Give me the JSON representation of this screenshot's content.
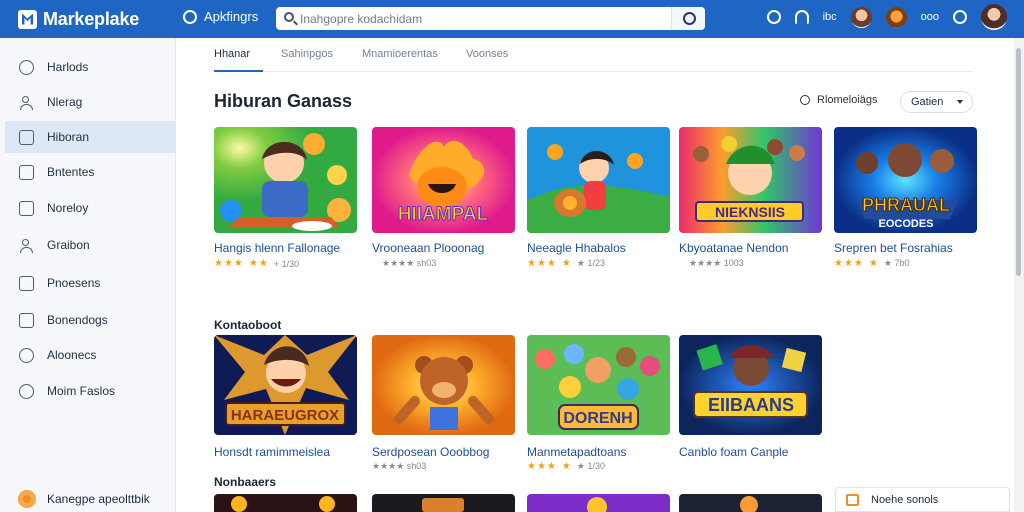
{
  "header": {
    "app_name": "Markeplake",
    "nav_label": "Apkfingrs",
    "search_value": "Inahgopre kodachidam",
    "right_text": "ibc",
    "right_text_2": "ooo"
  },
  "sidebar": {
    "items": [
      {
        "label": "Harlods"
      },
      {
        "label": "Nlerag"
      },
      {
        "label": "Hiboran"
      },
      {
        "label": "Bntentes"
      },
      {
        "label": "Noreloy"
      },
      {
        "label": "Graibon"
      },
      {
        "label": "Pnoesens"
      },
      {
        "label": "Bonendogs"
      },
      {
        "label": "Aloonecs"
      },
      {
        "label": "Moim Faslos"
      }
    ],
    "footer": "Kanegpe apeolttbik"
  },
  "tabs": [
    {
      "label": "Hhanar"
    },
    {
      "label": "Sahinpgos"
    },
    {
      "label": "Mnamioerentas"
    },
    {
      "label": "Voonses"
    }
  ],
  "page": {
    "title": "Hiburan Ganass",
    "sort_label": "Rlomeloiägs",
    "select_value": "Gatien"
  },
  "sections": {
    "second": "Kontaoboot",
    "third": "Nonbaaers"
  },
  "cards": [
    {
      "title": "Hangis hlenn Fallonage",
      "rating_text": "+ 1/30",
      "stars": "★★★",
      "dim": "★★"
    },
    {
      "title": "Vrooneaan Plooonag",
      "rating_text": "★★★★ sh03",
      "stars": "",
      "dim": ""
    },
    {
      "title": "Neeagle Hhabalos",
      "rating_text": "★ 1/23",
      "stars": "★★★",
      "dim": "★"
    },
    {
      "title": "Kbyoatanae Nendon",
      "rating_text": "★★★★ 1003",
      "stars": "",
      "dim": ""
    },
    {
      "title": "Srepren bet Fosrahias",
      "rating_text": "★ 7b0",
      "stars": "★★★",
      "dim": "★"
    },
    {
      "title": "Honsdt ramimmeislea",
      "rating_text": "",
      "stars": "",
      "dim": ""
    },
    {
      "title": "Serdposean Ooobbog",
      "rating_text": "★★★★ sh03",
      "stars": "",
      "dim": ""
    },
    {
      "title": "Manmetapadtoans",
      "rating_text": "★ 1/30",
      "stars": "★★★",
      "dim": "★"
    },
    {
      "title": "Canblo foam Canple",
      "rating_text": "",
      "stars": "",
      "dim": ""
    }
  ],
  "art_text": {
    "card2": "HIIAMPAL",
    "card4": "NIEKNSIIS",
    "card5": "PHRAUAL",
    "card5_sub": "EOCODES",
    "card6": "HARAEUGROX",
    "card8": "DORENH",
    "card9": "EIIBAANS"
  },
  "toast": {
    "label": "Noehe sonols"
  }
}
